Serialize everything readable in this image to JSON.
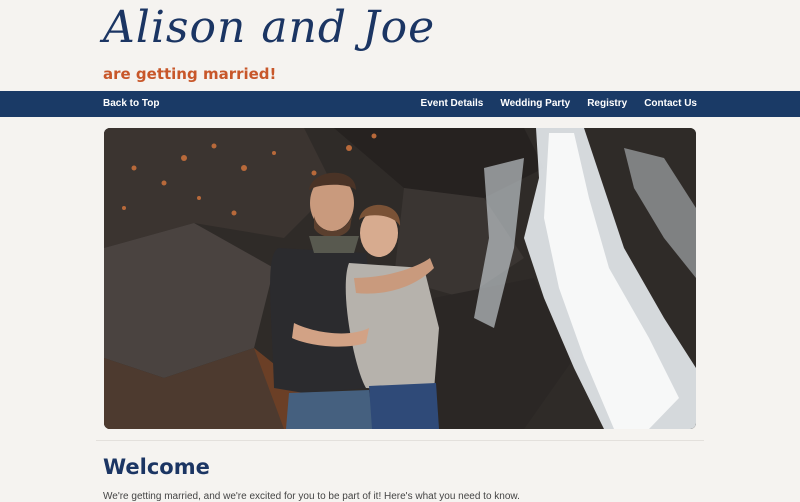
{
  "header": {
    "title": "Alison and Joe",
    "tagline": "are getting married!"
  },
  "nav": {
    "back_to_top": "Back to Top",
    "items": [
      {
        "label": "Event Details"
      },
      {
        "label": "Wedding Party"
      },
      {
        "label": "Registry"
      },
      {
        "label": "Contact Us"
      }
    ]
  },
  "hero": {
    "image_icon": "photo-couple-waterfall"
  },
  "main": {
    "heading": "Welcome",
    "intro": "We're getting married, and we're excited for you to be part of it! Here's what you need to know."
  },
  "colors": {
    "brand_navy": "#1a3a66",
    "accent_orange": "#c8572a",
    "background": "#f5f3f0"
  }
}
